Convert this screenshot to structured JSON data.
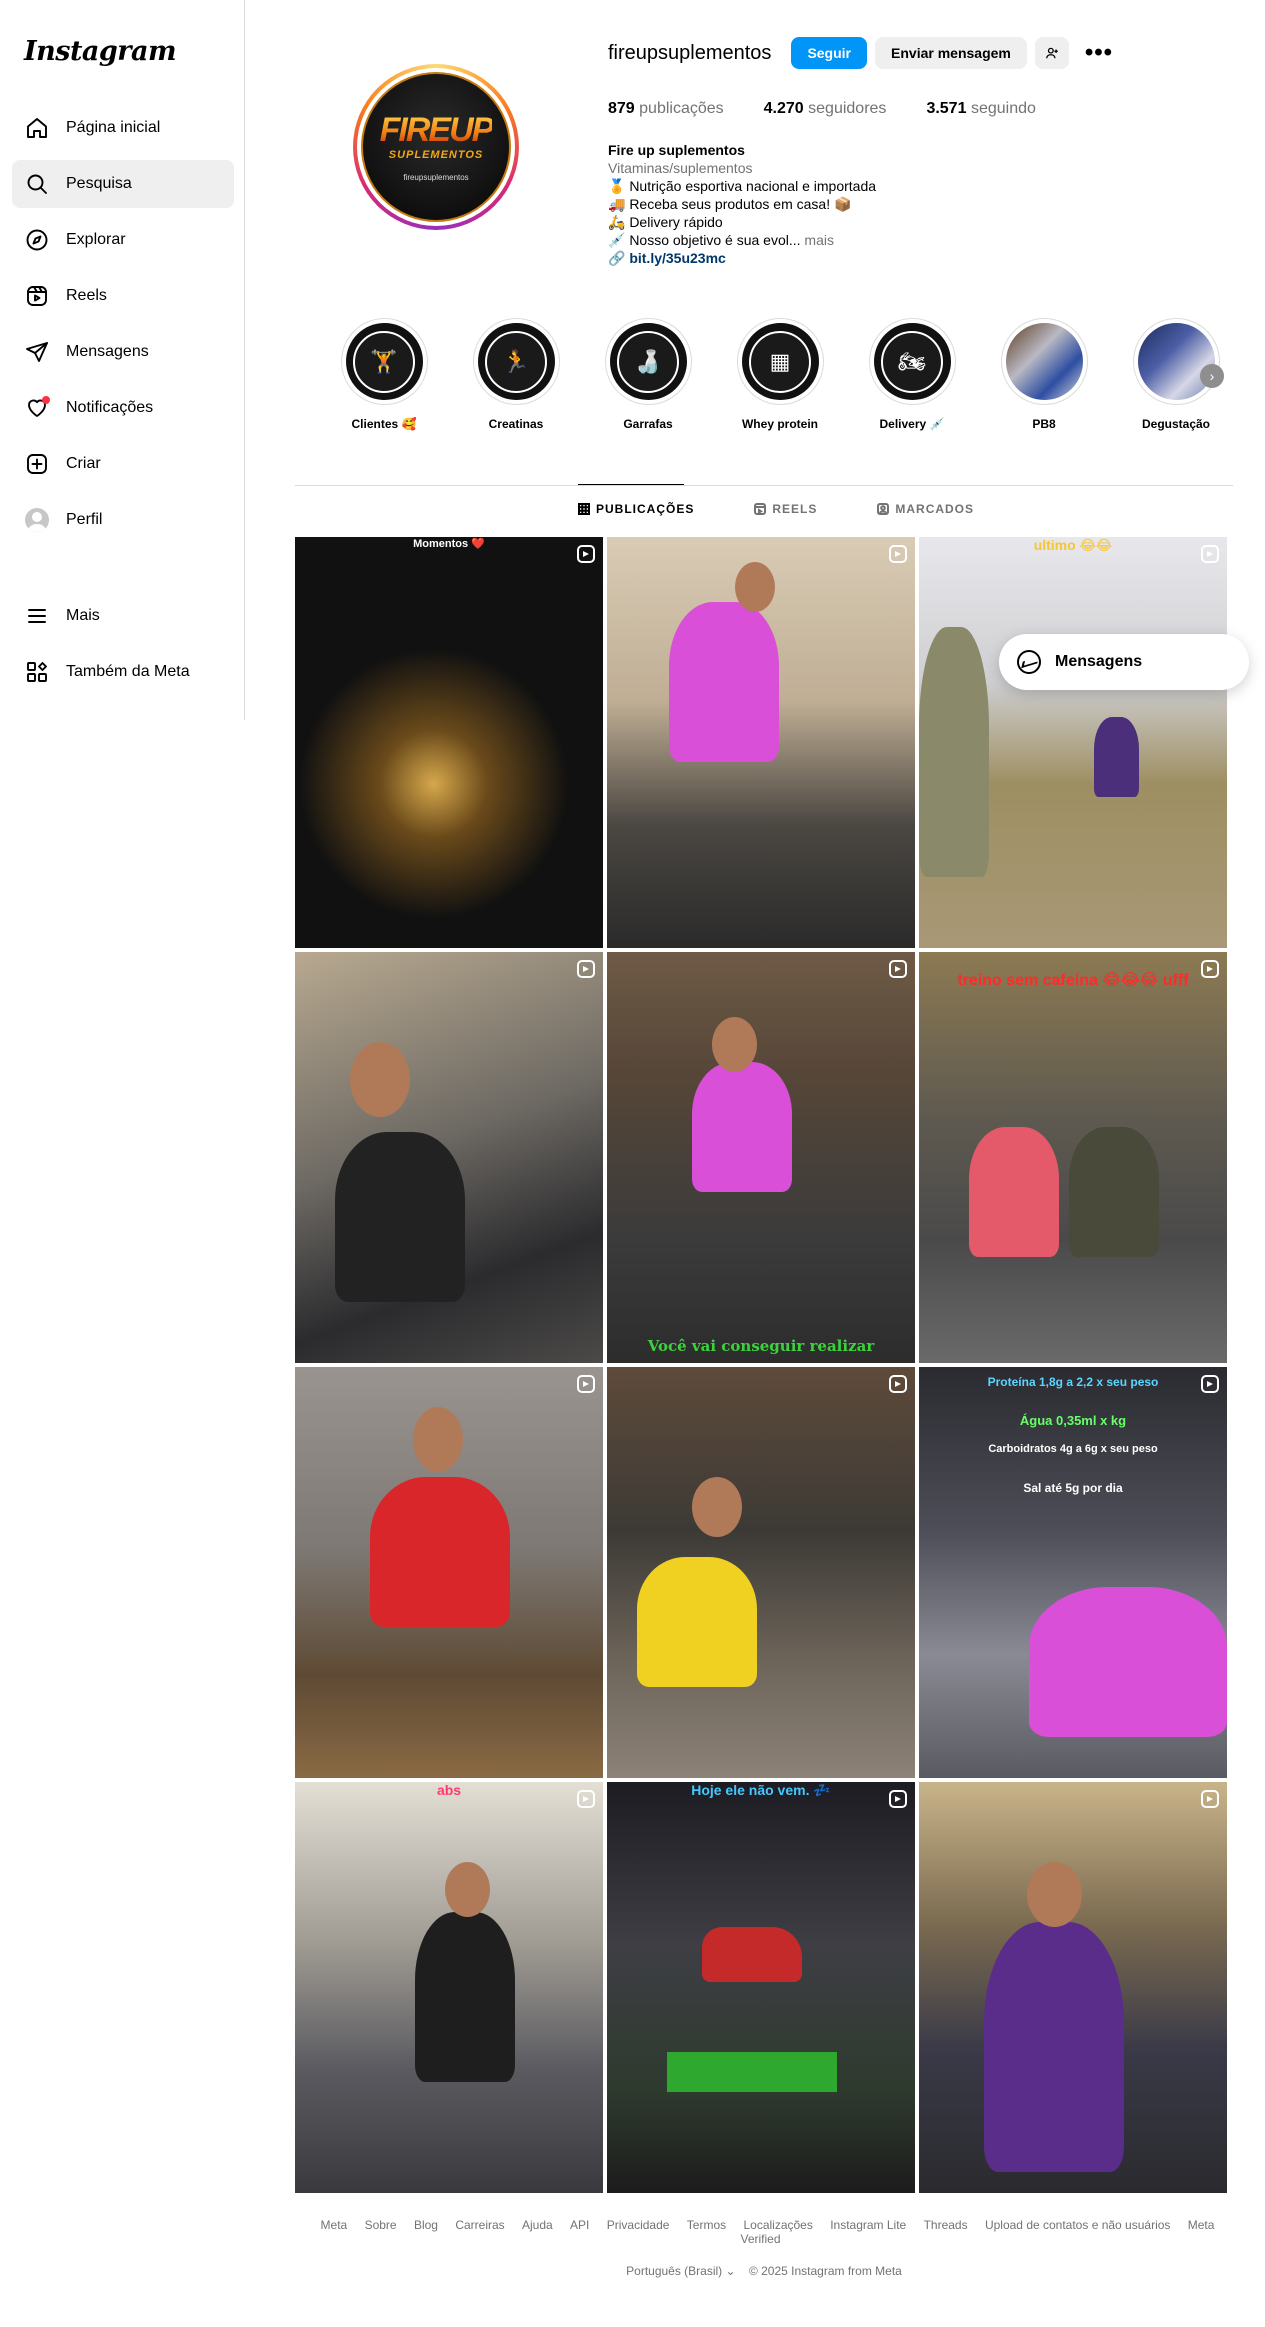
{
  "app": {
    "logo": "Instagram"
  },
  "sidebar": {
    "items": [
      {
        "label": "Página inicial",
        "icon": "home-icon"
      },
      {
        "label": "Pesquisa",
        "icon": "search-icon",
        "active": true
      },
      {
        "label": "Explorar",
        "icon": "compass-icon"
      },
      {
        "label": "Reels",
        "icon": "reels-icon"
      },
      {
        "label": "Mensagens",
        "icon": "send-icon"
      },
      {
        "label": "Notificações",
        "icon": "heart-icon"
      },
      {
        "label": "Criar",
        "icon": "plus-icon"
      },
      {
        "label": "Perfil",
        "icon": "avatar-icon"
      }
    ],
    "bottom_items": [
      {
        "label": "Mais",
        "icon": "menu-icon"
      },
      {
        "label": "Também da Meta",
        "icon": "meta-apps-icon"
      }
    ]
  },
  "profile": {
    "username": "fireupsuplementos",
    "follow_label": "Seguir",
    "message_label": "Enviar mensagem",
    "logo_text": "FIREUP",
    "logo_subtext": "SUPLEMENTOS",
    "logo_handle": "fireupsuplementos",
    "stats": [
      {
        "value": "879",
        "label": "publicações"
      },
      {
        "value": "4.270",
        "label": "seguidores"
      },
      {
        "value": "3.571",
        "label": "seguindo"
      }
    ],
    "bio": {
      "name": "Fire up suplementos",
      "category": "Vitaminas/suplementos",
      "lines": [
        "🏅 Nutrição esportiva nacional e importada",
        "🚚 Receba seus produtos em casa! 📦",
        "🛵 Delivery rápido",
        "💉 Nosso objetivo é sua evol..."
      ],
      "more_label": "mais",
      "link": "bit.ly/35u23mc"
    }
  },
  "highlights": [
    {
      "label": "Clientes 🥰",
      "glyph": "🏋"
    },
    {
      "label": "Creatinas",
      "glyph": "🏃"
    },
    {
      "label": "Garrafas",
      "glyph": "🍶"
    },
    {
      "label": "Whey protein",
      "glyph": "▦"
    },
    {
      "label": "Delivery 💉",
      "glyph": "🏍"
    },
    {
      "label": "PB8",
      "glyph": ""
    },
    {
      "label": "Degustação",
      "glyph": ""
    }
  ],
  "tabs": [
    {
      "label": "PUBLICAÇÕES",
      "active": true
    },
    {
      "label": "REELS"
    },
    {
      "label": "MARCADOS"
    }
  ],
  "grid_overlays": {
    "p1": "Momentos ❤️",
    "p3": "ultimo 😂😂",
    "p5": "Você vai conseguir realizar",
    "p6": "treino sem cafeína 😂😂😂 ufff",
    "p9a": "Proteína 1,8g a 2,2 x seu peso",
    "p9b": "Água 0,35ml x kg",
    "p9c": "Carboidratos 4g a 6g x seu peso",
    "p9d": "Sal até 5g por dia",
    "p10": "abs",
    "p11": "Hoje ele não vem. 💤"
  },
  "messages_popup": {
    "label": "Mensagens"
  },
  "footer": {
    "links": [
      "Meta",
      "Sobre",
      "Blog",
      "Carreiras",
      "Ajuda",
      "API",
      "Privacidade",
      "Termos",
      "Localizações",
      "Instagram Lite",
      "Threads",
      "Upload de contatos e não usuários",
      "Meta Verified"
    ],
    "language": "Português (Brasil)",
    "copyright": "© 2025 Instagram from Meta"
  }
}
